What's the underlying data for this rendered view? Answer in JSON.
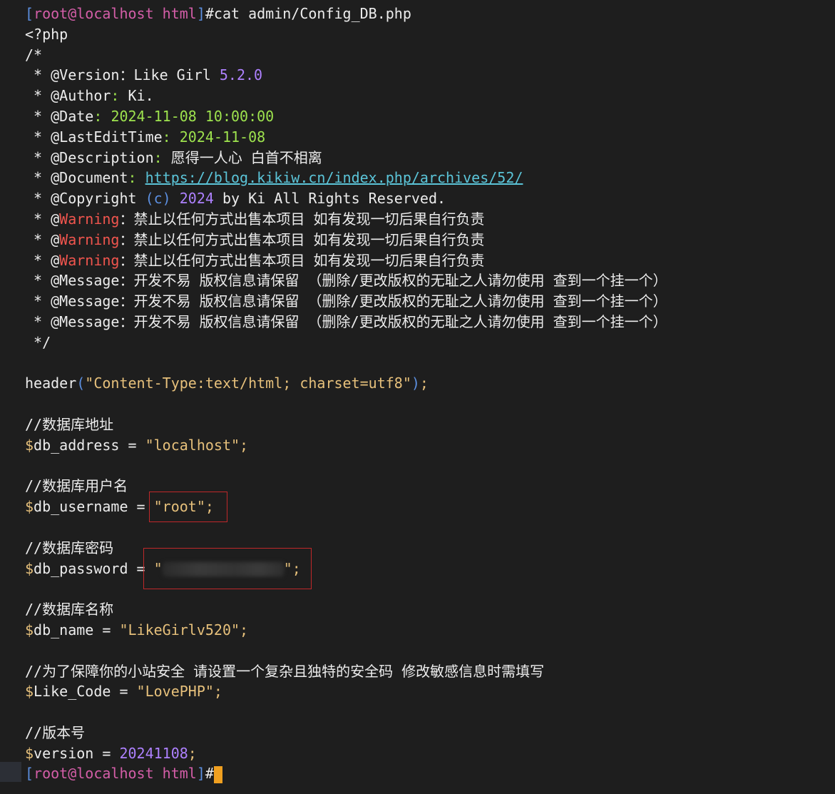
{
  "prompt": {
    "user_host": "root@localhost",
    "dir": "html",
    "command": "#cat admin/Config_DB.php"
  },
  "file": {
    "open_tag": "<?php",
    "comment_open": "/*",
    "version_key": "@Version",
    "version_sep": "：Like Girl ",
    "version_value": "5.2.0",
    "author_key": "@Author",
    "author_value": "Ki.",
    "date_key": "@Date",
    "date_value": "2024-11-08 10:00:00",
    "lastedit_key": "@LastEditTime",
    "lastedit_value": "2024-11-08",
    "desc_key": "@Description",
    "desc_value": "愿得一人心 白首不相离",
    "doc_key": "@Document",
    "doc_url": "https://blog.kikiw.cn/index.php/archives/52/",
    "copyright_key": "@Copyright",
    "copyright_c": "(c)",
    "copyright_year": "2024",
    "copyright_rest": "by Ki All Rights Reserved.",
    "warning_key": "Warning",
    "warning_text": "：禁止以任何方式出售本项目 如有发现一切后果自行负责",
    "message_key": "@Message",
    "message_text": "：开发不易 版权信息请保留 （删除/更改版权的无耻之人请勿使用 查到一个挂一个）",
    "comment_close": "*/",
    "header_call": "header",
    "header_arg": "\"Content-Type:text/html; charset=utf8\"",
    "comment_db_address": "//数据库地址",
    "db_address_var": "db_address",
    "db_address_value": "\"localhost\"",
    "comment_db_username": "//数据库用户名",
    "db_username_var": "db_username",
    "db_username_value": "\"root\"",
    "comment_db_password": "//数据库密码",
    "db_password_var": "db_password",
    "comment_db_name": "//数据库名称",
    "db_name_var": "db_name",
    "db_name_value": "\"LikeGirlv520\"",
    "comment_like_code": "//为了保障你的小站安全 请设置一个复杂且独特的安全码 修改敏感信息时需填写",
    "like_code_var": "Like_Code",
    "like_code_value": "\"LovePHP\"",
    "comment_version": "//版本号",
    "version_var": "version",
    "version_num": "20241108"
  },
  "colors": {
    "background": "#1e1e1e",
    "highlight_box": "#c0282a",
    "cursor": "#f0a020"
  }
}
